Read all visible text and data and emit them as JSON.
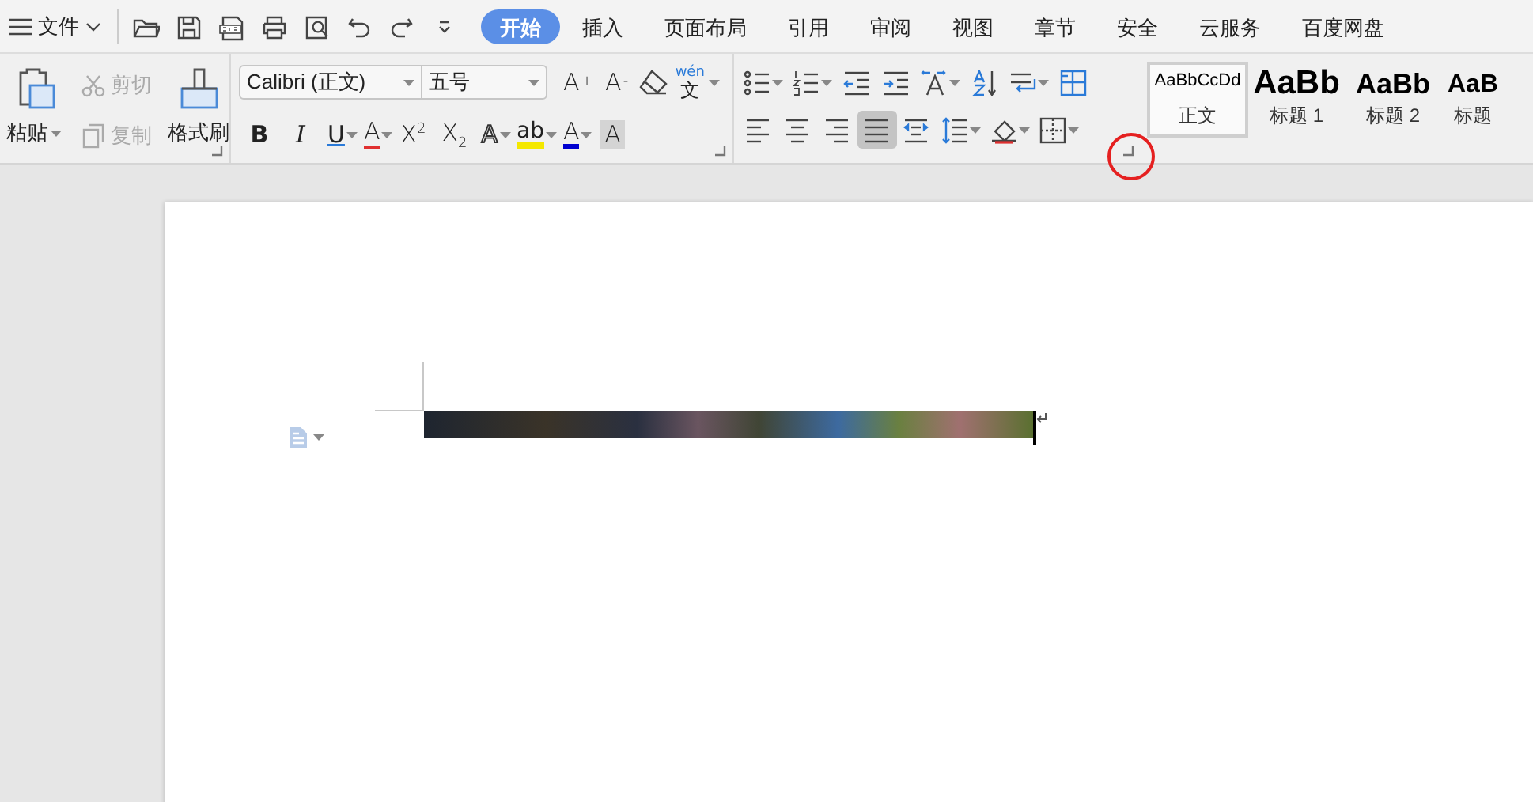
{
  "menu": {
    "label": "文件"
  },
  "tabs": [
    {
      "label": "开始",
      "selected": true
    },
    {
      "label": "插入",
      "selected": false
    },
    {
      "label": "页面布局",
      "selected": false
    },
    {
      "label": "引用",
      "selected": false
    },
    {
      "label": "审阅",
      "selected": false
    },
    {
      "label": "视图",
      "selected": false
    },
    {
      "label": "章节",
      "selected": false
    },
    {
      "label": "安全",
      "selected": false
    },
    {
      "label": "云服务",
      "selected": false
    },
    {
      "label": "百度网盘",
      "selected": false
    }
  ],
  "clipboard": {
    "paste": "粘贴",
    "cut": {
      "label": "剪切",
      "disabled": true
    },
    "copy": {
      "label": "复制",
      "disabled": true
    },
    "format_painter": "格式刷"
  },
  "font": {
    "name": "Calibri (正文)",
    "size": "五号",
    "size_buttons": [
      "A$^{+}$",
      "A$^{-}$"
    ],
    "phonetic_guide": {
      "ruby": "wén",
      "char": "文"
    },
    "format_buttons": [
      {
        "label": "B",
        "kind": "bold"
      },
      {
        "label": "I",
        "kind": "italic"
      },
      {
        "label": "U",
        "kind": "underline"
      },
      {
        "label": "A",
        "kind": "strike"
      },
      {
        "label": "X$^{2}$",
        "kind": "plain"
      },
      {
        "label": "X$_{2}$",
        "kind": "plain"
      },
      {
        "label": "A",
        "kind": "outline"
      },
      {
        "label": "ab",
        "kind": "highlight"
      },
      {
        "label": "A",
        "kind": "color"
      },
      {
        "label": "A",
        "kind": "shade"
      }
    ]
  },
  "alignment_buttons": [
    {
      "selected": false
    },
    {
      "selected": false
    },
    {
      "selected": false
    },
    {
      "selected": true
    },
    {
      "selected": false
    }
  ],
  "styles": [
    {
      "preview": "AaBbCcDd",
      "name": "正文",
      "selected": true,
      "kind": "body"
    },
    {
      "preview": "AaBb",
      "name": "标题 1",
      "selected": false,
      "kind": "h1"
    },
    {
      "preview": "AaBb",
      "name": "标题 2",
      "selected": false,
      "kind": "h2"
    },
    {
      "preview": "AaB",
      "name": "标题",
      "selected": false,
      "kind": "h3"
    }
  ]
}
